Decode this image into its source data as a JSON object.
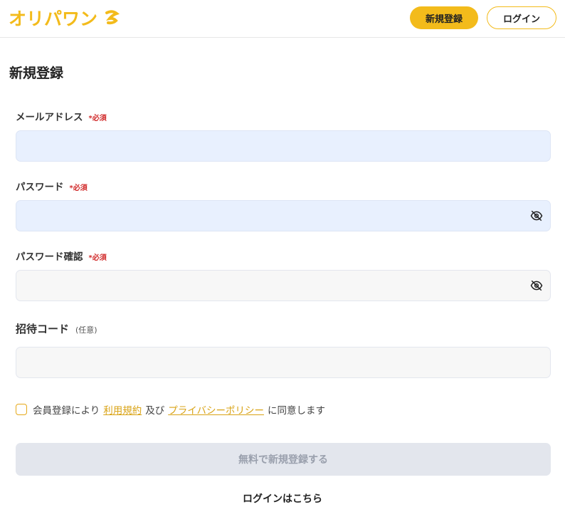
{
  "header": {
    "logo_text": "オリパワン",
    "register_label": "新規登録",
    "login_label": "ログイン"
  },
  "page": {
    "title": "新規登録"
  },
  "form": {
    "email": {
      "label": "メールアドレス",
      "required": "*必須",
      "value": ""
    },
    "password": {
      "label": "パスワード",
      "required": "*必須",
      "value": "",
      "icon": "eye-off-icon"
    },
    "password_confirm": {
      "label": "パスワード確認",
      "required": "*必須",
      "value": "",
      "icon": "eye-off-icon"
    },
    "invite": {
      "label": "招待コード",
      "optional": "(任意)",
      "value": ""
    },
    "agreement": {
      "prefix": "会員登録により",
      "terms_link": "利用規約",
      "middle": "及び",
      "privacy_link": "プライバシーポリシー",
      "suffix": "に同意します",
      "checked": false
    },
    "submit_label": "無料で新規登録する",
    "login_link": "ログインはこちら"
  },
  "colors": {
    "accent": "#f3bb1b",
    "required": "#d12b2b",
    "autofill_bg": "#e8f0fe",
    "disabled_button": "#e3e6ed"
  }
}
